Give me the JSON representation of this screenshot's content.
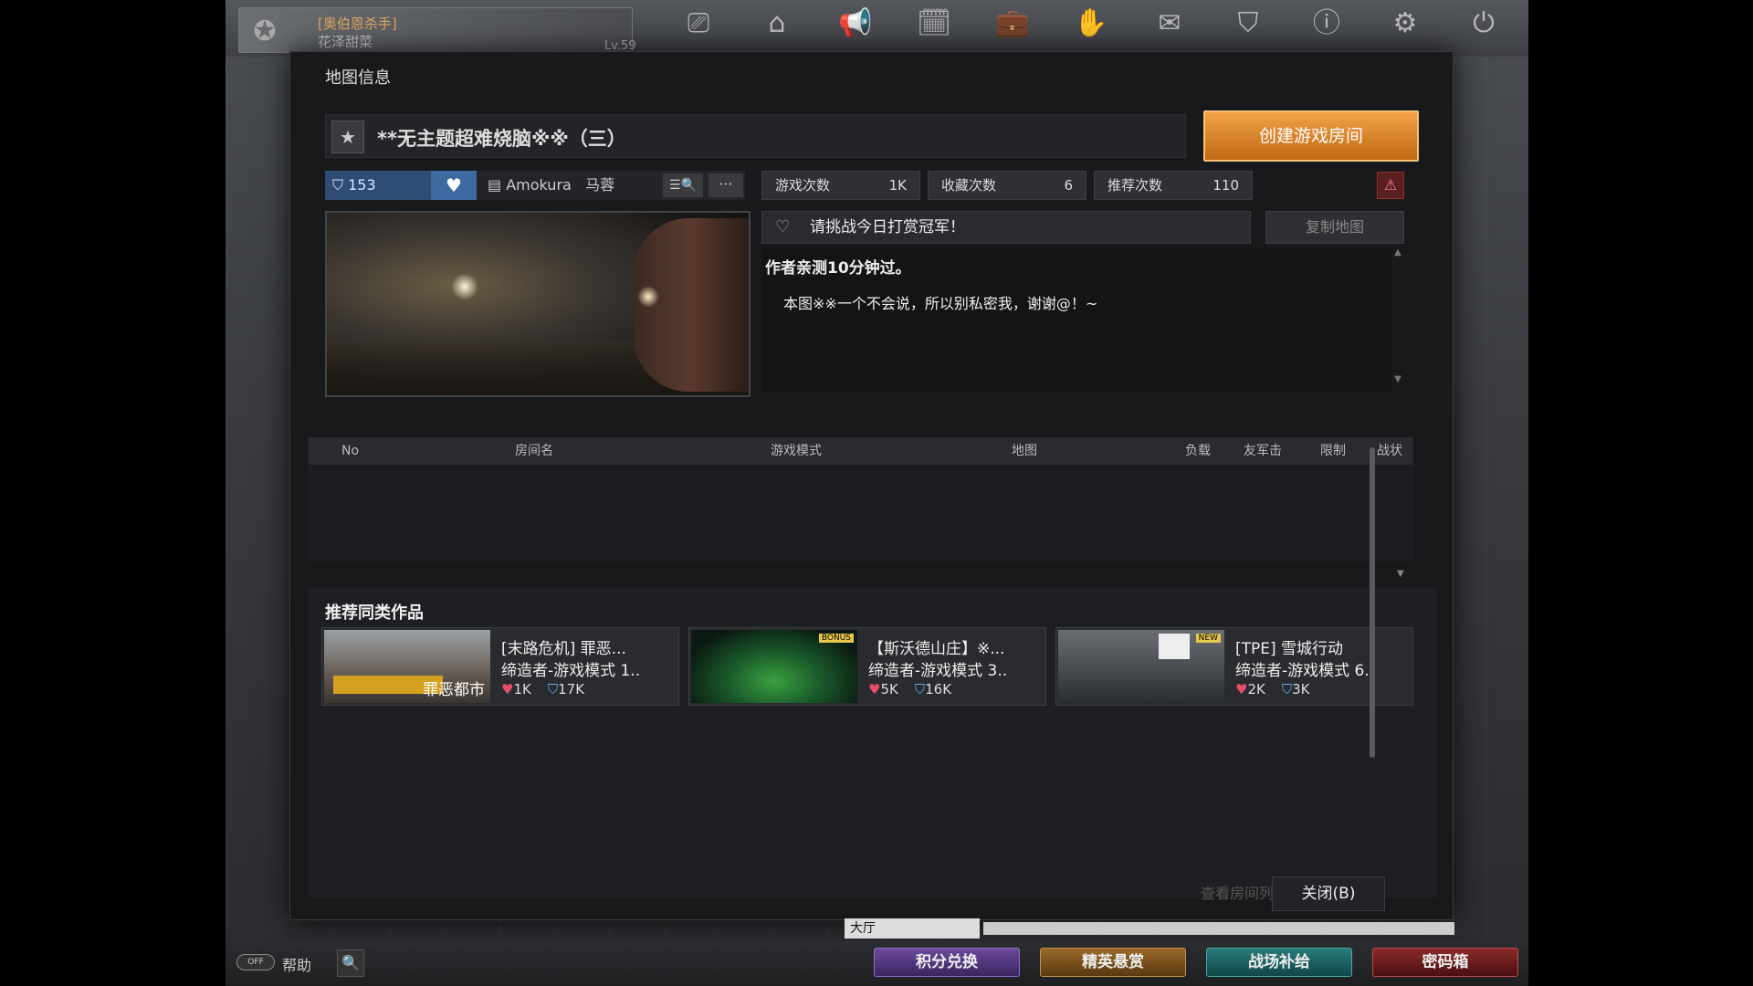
{
  "profile": {
    "title": "[奥伯恩杀手]",
    "nickname": "花泽甜菜",
    "level": "Lv.59"
  },
  "dialog": {
    "title": "地图信息",
    "map_name": "**无主题超难烧脑※※（三）",
    "create_room": "创建游戏房间",
    "likes": "153",
    "author_name": "Amokura",
    "author_name2": "马蓉",
    "stats": [
      {
        "key": "游戏次数",
        "value": "1K"
      },
      {
        "key": "收藏次数",
        "value": "6"
      },
      {
        "key": "推荐次数",
        "value": "110"
      }
    ],
    "challenge": "请挑战今日打赏冠军！",
    "copy_map": "复制地图",
    "desc_line1": "作者亲测10分钟过。",
    "desc_line2": "本图※※一个不会说，所以别私密我，谢谢@！~",
    "more": "···"
  },
  "room_table": {
    "columns": [
      "No",
      "房间名",
      "游戏模式",
      "地图",
      "负载",
      "友军击",
      "限制",
      "战状"
    ]
  },
  "recommended": {
    "title": "推荐同类作品",
    "items": [
      {
        "name": "[末路危机] 罪恶...",
        "mode": "缔造者-游戏模式 1..",
        "likes": "1K",
        "plays": "17K",
        "badge": "",
        "img_text": "罪恶都市"
      },
      {
        "name": "【斯沃德山庄】※...",
        "mode": "缔造者-游戏模式 3..",
        "likes": "5K",
        "plays": "16K",
        "badge": "BONUS",
        "img_text": ""
      },
      {
        "name": "[TPE] 雪城行动",
        "mode": "缔造者-游戏模式 6..",
        "likes": "2K",
        "plays": "3K",
        "badge": "NEW",
        "img_text": ""
      }
    ]
  },
  "close": "关闭(B)",
  "ghost": "查看房间列",
  "lobby": "大厅",
  "bottom": {
    "help": "帮助",
    "toggle": "OFF",
    "buttons": [
      "积分兑换",
      "精英悬赏",
      "战场补给",
      "密码箱"
    ]
  }
}
